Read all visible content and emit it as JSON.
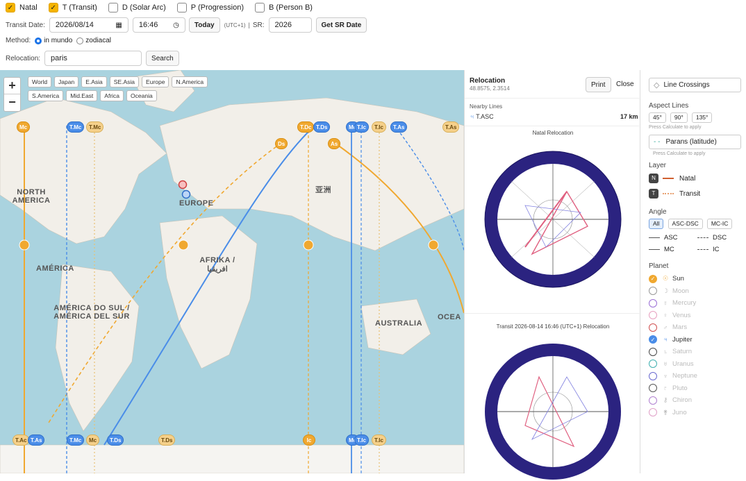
{
  "toolbar": {
    "checkboxes": [
      {
        "label": "Natal",
        "checked": true
      },
      {
        "label": "T (Transit)",
        "checked": true
      },
      {
        "label": "D (Solar Arc)",
        "checked": false
      },
      {
        "label": "P (Progression)",
        "checked": false
      },
      {
        "label": "B (Person B)",
        "checked": false
      }
    ],
    "transit_date_label": "Transit Date:",
    "transit_date": "2026/08/14",
    "transit_time": "16:46",
    "today_label": "Today",
    "utc": "(UTC+1)",
    "sr_label": "SR:",
    "sr_value": "2026",
    "get_sr_label": "Get SR Date",
    "method_label": "Method:",
    "method_in_mundo": "in mundo",
    "method_zodiacal": "zodiacal",
    "relocation_label": "Relocation:",
    "relocation_value": "paris",
    "search_label": "Search"
  },
  "map": {
    "regions_row1": [
      "World",
      "Japan",
      "E.Asia",
      "SE.Asia",
      "Europe",
      "N.America"
    ],
    "regions_row2": [
      "S.America",
      "Mid.East",
      "Africa",
      "Oceania"
    ],
    "labels": {
      "north_america": "NORTH AMERICA",
      "europe": "EUROPE",
      "asia": "亚洲",
      "america": "AMÉRICA",
      "south_america": "AMÉRICA DO SUL / AMÉRICA DEL SUR",
      "africa": "AFRIKA / افريقيا",
      "australia": "AUSTRALIA",
      "ocean": "OCEA"
    },
    "badges_top": [
      "Mc",
      "T.Mc",
      "T.Mc",
      "T.Dc",
      "T.Ds",
      "Mc",
      "T.Ic",
      "T.Ic",
      "T.As",
      "T.As"
    ],
    "badges_mid": [
      "Ds",
      "As"
    ],
    "badges_bottom": [
      "T.Ac",
      "T.As",
      "T.Mc",
      "Mc",
      "T.Ds",
      "T.Ds",
      "Ic",
      "Mc",
      "T.Ic",
      "T.Ic"
    ],
    "colors": {
      "natal": "#f0a830",
      "transit": "#4a8de8"
    }
  },
  "panel": {
    "title": "Relocation",
    "coords": "48.8575, 2.3514",
    "print_label": "Print",
    "close_label": "Close",
    "nearby_title": "Nearby Lines",
    "nearby_line": "T.ASC",
    "nearby_dist": "17 km",
    "natal_chart_title": "Natal Relocation",
    "transit_chart_title": "Transit 2026-08-14 16:46 (UTC+1) Relocation"
  },
  "side": {
    "line_crossings": "Line Crossings",
    "aspect_lines_title": "Aspect Lines",
    "aspect_buttons": [
      "45°",
      "90°",
      "135°"
    ],
    "calc_note": "Press Calculate to apply",
    "parans_label": "Parans (latitude)",
    "calc_note2": "Press Calculate to apply",
    "layer_title": "Layer",
    "layer_natal": "Natal",
    "layer_transit": "Transit",
    "angle_title": "Angle",
    "angle_buttons": [
      "All",
      "ASC-DSC",
      "MC-IC"
    ],
    "angles": [
      "ASC",
      "DSC",
      "MC",
      "IC"
    ],
    "planet_title": "Planet",
    "planets": [
      {
        "name": "Sun",
        "glyph": "☉",
        "on": true,
        "color": "#f0a830"
      },
      {
        "name": "Moon",
        "glyph": "☽",
        "on": false,
        "color": "#999999"
      },
      {
        "name": "Mercury",
        "glyph": "☿",
        "on": false,
        "color": "#9b6fd6"
      },
      {
        "name": "Venus",
        "glyph": "♀",
        "on": false,
        "color": "#e8a0c0"
      },
      {
        "name": "Mars",
        "glyph": "♂",
        "on": false,
        "color": "#d05050"
      },
      {
        "name": "Jupiter",
        "glyph": "♃",
        "on": true,
        "color": "#4a8de8"
      },
      {
        "name": "Saturn",
        "glyph": "♄",
        "on": false,
        "color": "#444444"
      },
      {
        "name": "Uranus",
        "glyph": "♅",
        "on": false,
        "color": "#40b0b0"
      },
      {
        "name": "Neptune",
        "glyph": "♆",
        "on": false,
        "color": "#6a6ad0"
      },
      {
        "name": "Pluto",
        "glyph": "♇",
        "on": false,
        "color": "#555555"
      },
      {
        "name": "Chiron",
        "glyph": "⚷",
        "on": false,
        "color": "#b080d0"
      },
      {
        "name": "Juno",
        "glyph": "⚵",
        "on": false,
        "color": "#e0a0c8"
      }
    ]
  }
}
